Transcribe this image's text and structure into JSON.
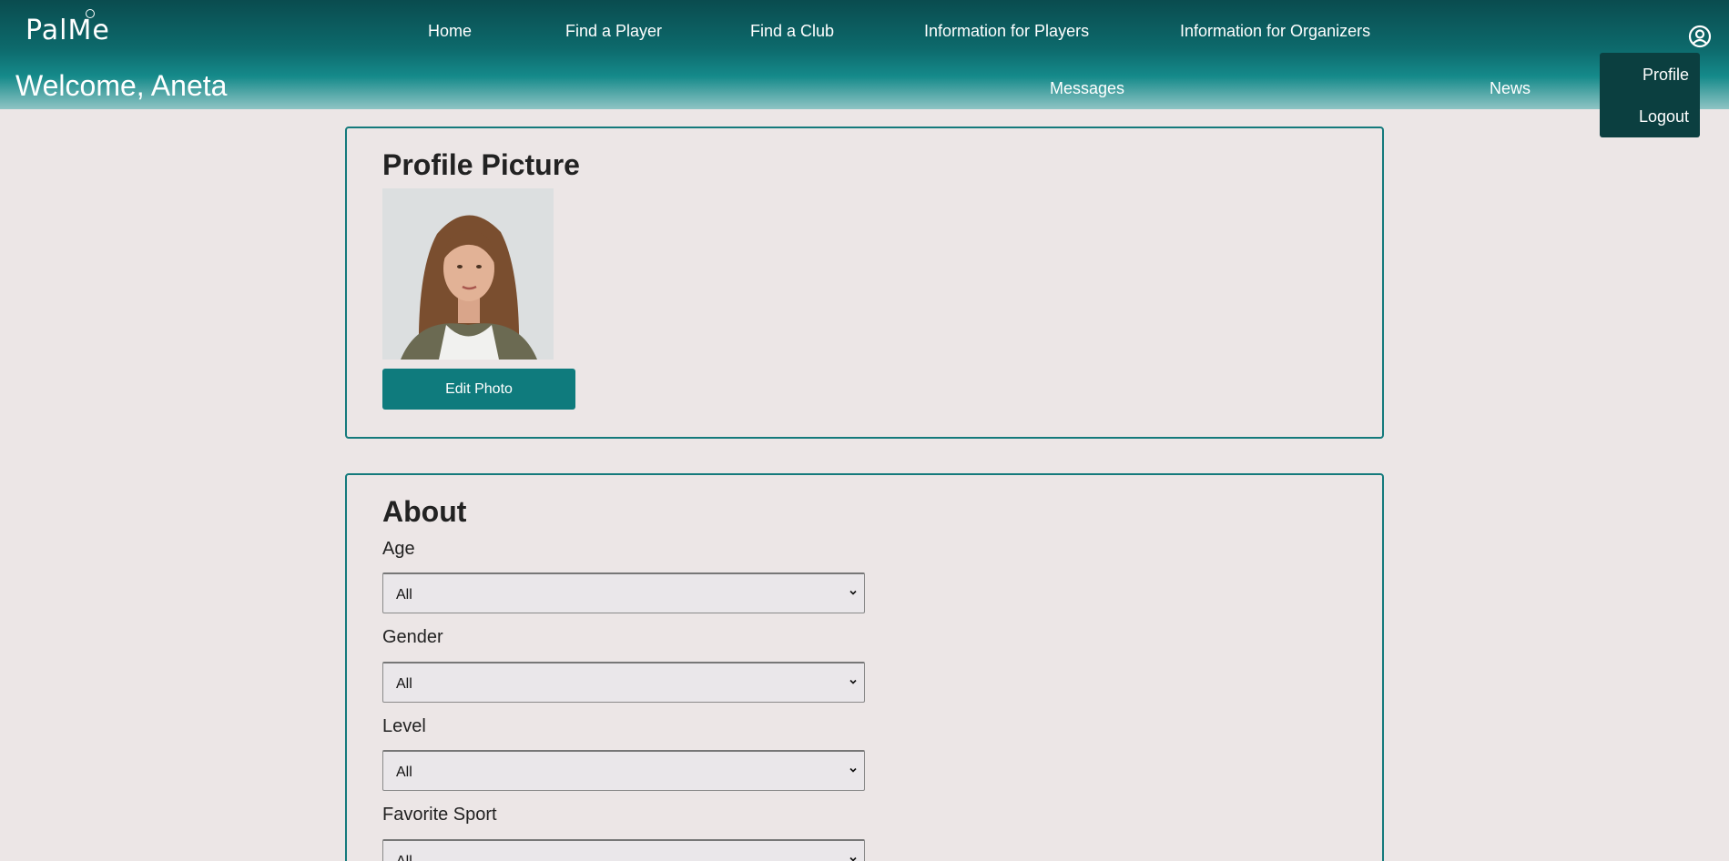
{
  "brand": {
    "logo_text": "PalMe"
  },
  "nav": {
    "home": "Home",
    "find_player": "Find a Player",
    "find_club": "Find a Club",
    "info_players": "Information for Players",
    "info_organizers": "Information for Organizers"
  },
  "welcome": "Welcome, Aneta",
  "sub_nav": {
    "messages": "Messages",
    "news": "News"
  },
  "user_menu": {
    "icon": "user-circle-icon",
    "items": [
      "Profile",
      "Logout"
    ]
  },
  "profile_picture": {
    "title": "Profile Picture",
    "edit_button": "Edit Photo"
  },
  "about": {
    "title": "About",
    "fields": [
      {
        "label": "Age",
        "value": "All"
      },
      {
        "label": "Gender",
        "value": "All"
      },
      {
        "label": "Level",
        "value": "All"
      },
      {
        "label": "Favorite Sport",
        "value": "All"
      }
    ]
  },
  "colors": {
    "header_dark": "#0a4c4f",
    "accent": "#0f7b7d",
    "card_border": "#147a7c",
    "background": "#ece6e6",
    "dropdown_bg": "#0b3f40"
  }
}
